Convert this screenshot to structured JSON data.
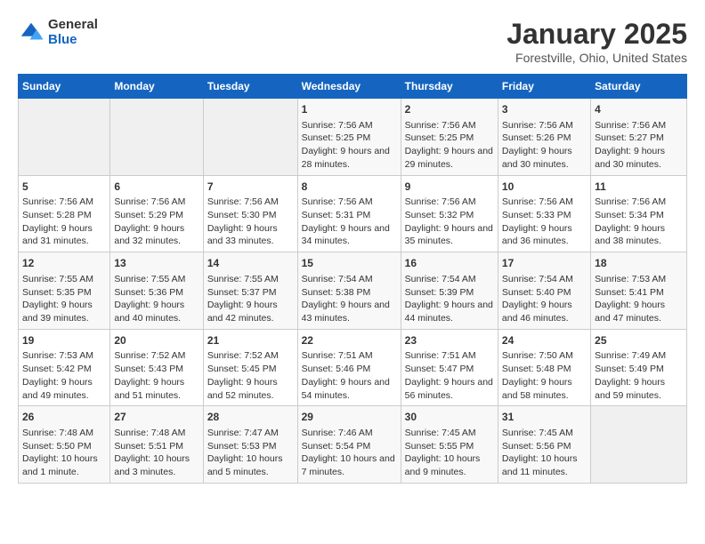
{
  "logo": {
    "general": "General",
    "blue": "Blue"
  },
  "title": "January 2025",
  "subtitle": "Forestville, Ohio, United States",
  "days_of_week": [
    "Sunday",
    "Monday",
    "Tuesday",
    "Wednesday",
    "Thursday",
    "Friday",
    "Saturday"
  ],
  "weeks": [
    [
      {
        "day": "",
        "empty": true
      },
      {
        "day": "",
        "empty": true
      },
      {
        "day": "",
        "empty": true
      },
      {
        "day": "1",
        "sunrise": "Sunrise: 7:56 AM",
        "sunset": "Sunset: 5:25 PM",
        "daylight": "Daylight: 9 hours and 28 minutes."
      },
      {
        "day": "2",
        "sunrise": "Sunrise: 7:56 AM",
        "sunset": "Sunset: 5:25 PM",
        "daylight": "Daylight: 9 hours and 29 minutes."
      },
      {
        "day": "3",
        "sunrise": "Sunrise: 7:56 AM",
        "sunset": "Sunset: 5:26 PM",
        "daylight": "Daylight: 9 hours and 30 minutes."
      },
      {
        "day": "4",
        "sunrise": "Sunrise: 7:56 AM",
        "sunset": "Sunset: 5:27 PM",
        "daylight": "Daylight: 9 hours and 30 minutes."
      }
    ],
    [
      {
        "day": "5",
        "sunrise": "Sunrise: 7:56 AM",
        "sunset": "Sunset: 5:28 PM",
        "daylight": "Daylight: 9 hours and 31 minutes."
      },
      {
        "day": "6",
        "sunrise": "Sunrise: 7:56 AM",
        "sunset": "Sunset: 5:29 PM",
        "daylight": "Daylight: 9 hours and 32 minutes."
      },
      {
        "day": "7",
        "sunrise": "Sunrise: 7:56 AM",
        "sunset": "Sunset: 5:30 PM",
        "daylight": "Daylight: 9 hours and 33 minutes."
      },
      {
        "day": "8",
        "sunrise": "Sunrise: 7:56 AM",
        "sunset": "Sunset: 5:31 PM",
        "daylight": "Daylight: 9 hours and 34 minutes."
      },
      {
        "day": "9",
        "sunrise": "Sunrise: 7:56 AM",
        "sunset": "Sunset: 5:32 PM",
        "daylight": "Daylight: 9 hours and 35 minutes."
      },
      {
        "day": "10",
        "sunrise": "Sunrise: 7:56 AM",
        "sunset": "Sunset: 5:33 PM",
        "daylight": "Daylight: 9 hours and 36 minutes."
      },
      {
        "day": "11",
        "sunrise": "Sunrise: 7:56 AM",
        "sunset": "Sunset: 5:34 PM",
        "daylight": "Daylight: 9 hours and 38 minutes."
      }
    ],
    [
      {
        "day": "12",
        "sunrise": "Sunrise: 7:55 AM",
        "sunset": "Sunset: 5:35 PM",
        "daylight": "Daylight: 9 hours and 39 minutes."
      },
      {
        "day": "13",
        "sunrise": "Sunrise: 7:55 AM",
        "sunset": "Sunset: 5:36 PM",
        "daylight": "Daylight: 9 hours and 40 minutes."
      },
      {
        "day": "14",
        "sunrise": "Sunrise: 7:55 AM",
        "sunset": "Sunset: 5:37 PM",
        "daylight": "Daylight: 9 hours and 42 minutes."
      },
      {
        "day": "15",
        "sunrise": "Sunrise: 7:54 AM",
        "sunset": "Sunset: 5:38 PM",
        "daylight": "Daylight: 9 hours and 43 minutes."
      },
      {
        "day": "16",
        "sunrise": "Sunrise: 7:54 AM",
        "sunset": "Sunset: 5:39 PM",
        "daylight": "Daylight: 9 hours and 44 minutes."
      },
      {
        "day": "17",
        "sunrise": "Sunrise: 7:54 AM",
        "sunset": "Sunset: 5:40 PM",
        "daylight": "Daylight: 9 hours and 46 minutes."
      },
      {
        "day": "18",
        "sunrise": "Sunrise: 7:53 AM",
        "sunset": "Sunset: 5:41 PM",
        "daylight": "Daylight: 9 hours and 47 minutes."
      }
    ],
    [
      {
        "day": "19",
        "sunrise": "Sunrise: 7:53 AM",
        "sunset": "Sunset: 5:42 PM",
        "daylight": "Daylight: 9 hours and 49 minutes."
      },
      {
        "day": "20",
        "sunrise": "Sunrise: 7:52 AM",
        "sunset": "Sunset: 5:43 PM",
        "daylight": "Daylight: 9 hours and 51 minutes."
      },
      {
        "day": "21",
        "sunrise": "Sunrise: 7:52 AM",
        "sunset": "Sunset: 5:45 PM",
        "daylight": "Daylight: 9 hours and 52 minutes."
      },
      {
        "day": "22",
        "sunrise": "Sunrise: 7:51 AM",
        "sunset": "Sunset: 5:46 PM",
        "daylight": "Daylight: 9 hours and 54 minutes."
      },
      {
        "day": "23",
        "sunrise": "Sunrise: 7:51 AM",
        "sunset": "Sunset: 5:47 PM",
        "daylight": "Daylight: 9 hours and 56 minutes."
      },
      {
        "day": "24",
        "sunrise": "Sunrise: 7:50 AM",
        "sunset": "Sunset: 5:48 PM",
        "daylight": "Daylight: 9 hours and 58 minutes."
      },
      {
        "day": "25",
        "sunrise": "Sunrise: 7:49 AM",
        "sunset": "Sunset: 5:49 PM",
        "daylight": "Daylight: 9 hours and 59 minutes."
      }
    ],
    [
      {
        "day": "26",
        "sunrise": "Sunrise: 7:48 AM",
        "sunset": "Sunset: 5:50 PM",
        "daylight": "Daylight: 10 hours and 1 minute."
      },
      {
        "day": "27",
        "sunrise": "Sunrise: 7:48 AM",
        "sunset": "Sunset: 5:51 PM",
        "daylight": "Daylight: 10 hours and 3 minutes."
      },
      {
        "day": "28",
        "sunrise": "Sunrise: 7:47 AM",
        "sunset": "Sunset: 5:53 PM",
        "daylight": "Daylight: 10 hours and 5 minutes."
      },
      {
        "day": "29",
        "sunrise": "Sunrise: 7:46 AM",
        "sunset": "Sunset: 5:54 PM",
        "daylight": "Daylight: 10 hours and 7 minutes."
      },
      {
        "day": "30",
        "sunrise": "Sunrise: 7:45 AM",
        "sunset": "Sunset: 5:55 PM",
        "daylight": "Daylight: 10 hours and 9 minutes."
      },
      {
        "day": "31",
        "sunrise": "Sunrise: 7:45 AM",
        "sunset": "Sunset: 5:56 PM",
        "daylight": "Daylight: 10 hours and 11 minutes."
      },
      {
        "day": "",
        "empty": true
      }
    ]
  ]
}
